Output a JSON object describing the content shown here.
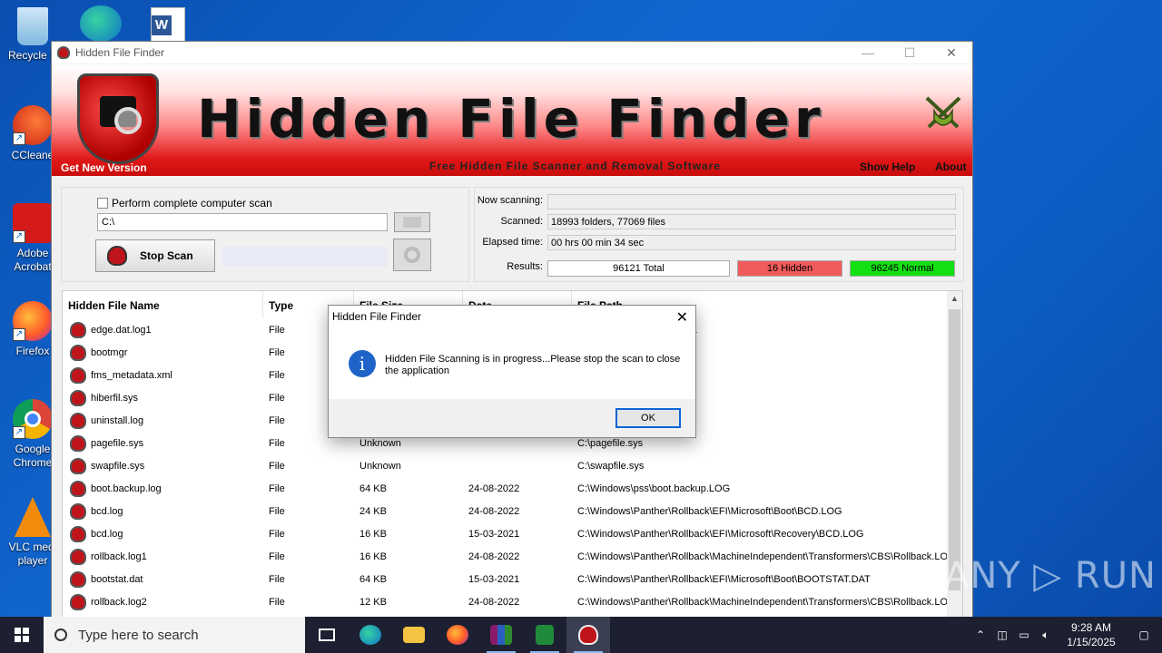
{
  "desktop": {
    "icons": [
      {
        "label": "Recycle Bin",
        "shown_label": "Recycle B"
      },
      {
        "label": "CCleaner",
        "shown_label": "CCleane"
      },
      {
        "label": "Adobe Acrobat",
        "line1": "Adobe",
        "line2": "Acrobat"
      },
      {
        "label": "Firefox",
        "shown_label": "Firefox"
      },
      {
        "label": "Google Chrome",
        "line1": "Google",
        "line2": "Chrome"
      },
      {
        "label": "VLC media player",
        "line1": "VLC medi",
        "line2": "player"
      }
    ]
  },
  "window": {
    "title": "Hidden File Finder",
    "minimize": "—",
    "maximize": "☐",
    "close": "✕"
  },
  "banner": {
    "title": "Hidden File Finder",
    "subtitle": "Free Hidden File Scanner and Removal Software",
    "get_new_version": "Get New Version",
    "show_help": "Show Help",
    "about": "About"
  },
  "controls": {
    "complete_scan_label": "Perform complete computer scan",
    "complete_scan_checked": false,
    "path_value": "C:\\",
    "stop_scan_label": "Stop Scan"
  },
  "status": {
    "now_scanning_label": "Now scanning:",
    "now_scanning_value": "",
    "scanned_label": "Scanned:",
    "scanned_value": "18993 folders, 77069 files",
    "elapsed_label": "Elapsed time:",
    "elapsed_value": "00 hrs 00 min 34 sec",
    "results_label": "Results:",
    "total": "96121 Total",
    "hidden": "16 Hidden",
    "normal": "96245 Normal",
    "hidden_color": "#f15b5b",
    "normal_color": "#12e012"
  },
  "table": {
    "columns": [
      "Hidden File Name",
      "Type",
      "File Size",
      "Date",
      "File Path"
    ],
    "rows": [
      {
        "name": "edge.dat.log1",
        "type": "File",
        "size": "",
        "date": "",
        "path": "osoft\\Edge\\Edge.dat.LOG1"
      },
      {
        "name": "bootmgr",
        "type": "File",
        "size": "",
        "date": "",
        "path": ""
      },
      {
        "name": "fms_metadata.xml",
        "type": "File",
        "size": "",
        "date": "",
        "path": "adata.xml"
      },
      {
        "name": "hiberfil.sys",
        "type": "File",
        "size": "",
        "date": "",
        "path": ""
      },
      {
        "name": "uninstall.log",
        "type": "File",
        "size": "",
        "date": "",
        "path": "VLC\\uninstall.log"
      },
      {
        "name": "pagefile.sys",
        "type": "File",
        "size": "Unknown",
        "date": "",
        "path": "C:\\pagefile.sys"
      },
      {
        "name": "swapfile.sys",
        "type": "File",
        "size": "Unknown",
        "date": "",
        "path": "C:\\swapfile.sys"
      },
      {
        "name": "boot.backup.log",
        "type": "File",
        "size": "64 KB",
        "date": "24-08-2022",
        "path": "C:\\Windows\\pss\\boot.backup.LOG"
      },
      {
        "name": "bcd.log",
        "type": "File",
        "size": "24 KB",
        "date": "24-08-2022",
        "path": "C:\\Windows\\Panther\\Rollback\\EFI\\Microsoft\\Boot\\BCD.LOG"
      },
      {
        "name": "bcd.log",
        "type": "File",
        "size": "16 KB",
        "date": "15-03-2021",
        "path": "C:\\Windows\\Panther\\Rollback\\EFI\\Microsoft\\Recovery\\BCD.LOG"
      },
      {
        "name": "rollback.log1",
        "type": "File",
        "size": "16 KB",
        "date": "24-08-2022",
        "path": "C:\\Windows\\Panther\\Rollback\\MachineIndependent\\Transformers\\CBS\\Rollback.LOG1"
      },
      {
        "name": "bootstat.dat",
        "type": "File",
        "size": "64 KB",
        "date": "15-03-2021",
        "path": "C:\\Windows\\Panther\\Rollback\\EFI\\Microsoft\\Boot\\BOOTSTAT.DAT"
      },
      {
        "name": "rollback.log2",
        "type": "File",
        "size": "12 KB",
        "date": "24-08-2022",
        "path": "C:\\Windows\\Panther\\Rollback\\MachineIndependent\\Transformers\\CBS\\Rollback.LOG2"
      },
      {
        "name": "",
        "type": "",
        "size": "64 KB",
        "date": "24-08-2022",
        "path": "C:\\Windows\\Panther\\Rollback\\MachineIndependent\\Transformers\\CBS\\Rollback(c64."
      }
    ]
  },
  "dialog": {
    "title": "Hidden File Finder",
    "close": "✕",
    "icon": "i",
    "message": "Hidden File Scanning is in progress...Please stop the scan to close the application",
    "ok": "OK"
  },
  "watermark": "ANY ▷ RUN",
  "taskbar": {
    "search_placeholder": "Type here to search",
    "time": "9:28 AM",
    "date": "1/15/2025"
  }
}
